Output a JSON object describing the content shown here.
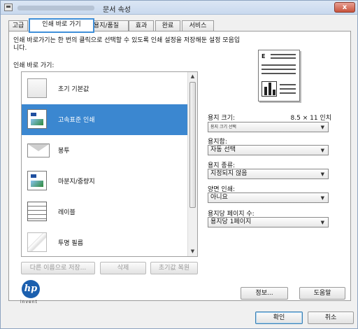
{
  "window": {
    "title": "문서 속성",
    "close_label": "x"
  },
  "tabs": [
    {
      "label": "고급"
    },
    {
      "label": "인쇄 바로 가기"
    },
    {
      "label": "용지/품질"
    },
    {
      "label": "효과"
    },
    {
      "label": "완료"
    },
    {
      "label": "서비스"
    }
  ],
  "shortcuts": {
    "description": "인쇄 바로가기는 한 번의 클릭으로 선택할 수 있도록 인쇄 설정을 저장해둔 설정 모음입니다.",
    "list_label": "인쇄 바로 가기:",
    "items": [
      {
        "label": "초기 기본값",
        "icon": "blank-page-icon"
      },
      {
        "label": "고속표준 인쇄",
        "icon": "photo-page-icon"
      },
      {
        "label": "봉투",
        "icon": "envelope-icon"
      },
      {
        "label": "마분지/중량지",
        "icon": "cardstock-icon"
      },
      {
        "label": "레이블",
        "icon": "labels-icon"
      },
      {
        "label": "투명 필름",
        "icon": "transparency-icon"
      }
    ],
    "selected_index": 1,
    "buttons": {
      "save_as": "다른 이름으로 저장...",
      "delete": "삭제",
      "reset": "초기값 복원"
    }
  },
  "settings": {
    "paper_size_label": "용지 크기:",
    "paper_size_value": "8.5 × 11 인치",
    "paper_size_select": "용지 크기 선택",
    "paper_source_label": "용지함:",
    "paper_source_value": "자동 선택",
    "paper_type_label": "용지 종류:",
    "paper_type_value": "지정되지 않음",
    "duplex_label": "양면 인쇄:",
    "duplex_value": "아니요",
    "pages_per_sheet_label": "용지당 페이지 수:",
    "pages_per_sheet_value": "용지당 1페이지"
  },
  "footer": {
    "logo_text": "hp",
    "logo_tagline": "invent",
    "about_label": "정보...",
    "help_label": "도움말",
    "ok_label": "확인",
    "cancel_label": "취소"
  },
  "colors": {
    "selection": "#3b87d0",
    "active_tab_outline": "#3f8fd9",
    "hp_blue": "#1b5fae"
  }
}
